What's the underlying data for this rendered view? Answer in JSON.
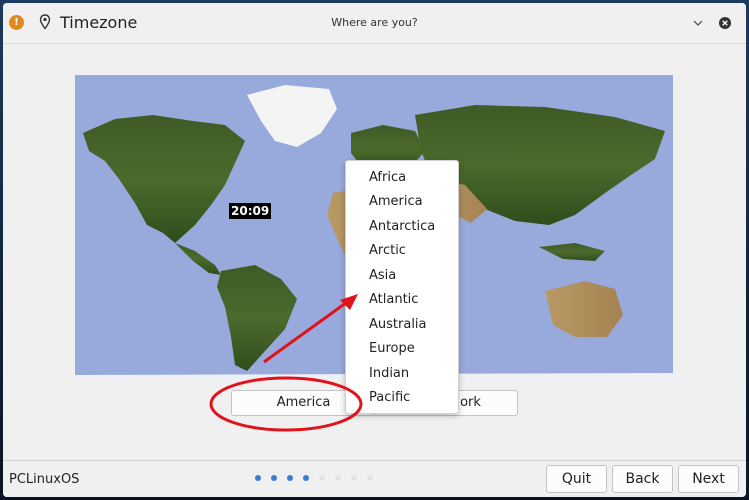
{
  "window": {
    "title": "Timezone",
    "subtitle": "Where are you?",
    "icons": {
      "app": "app-icon",
      "location": "location-pin-icon",
      "collapse": "chevron-down-icon",
      "close": "close-icon"
    }
  },
  "map": {
    "time_label": "20:09",
    "ocean_color": "#98a9dc"
  },
  "region_select": {
    "selected": "America",
    "zone_visible_text": "ork"
  },
  "dropdown": {
    "items": [
      "Africa",
      "America",
      "Antarctica",
      "Arctic",
      "Asia",
      "Atlantic",
      "Australia",
      "Europe",
      "Indian",
      "Pacific"
    ]
  },
  "footer": {
    "brand": "PCLinuxOS",
    "progress": {
      "total_steps": 8,
      "completed_steps": 4
    },
    "buttons": {
      "quit": "Quit",
      "back": "Back",
      "next": "Next"
    }
  },
  "annotations": {
    "color": "#e0121b"
  }
}
